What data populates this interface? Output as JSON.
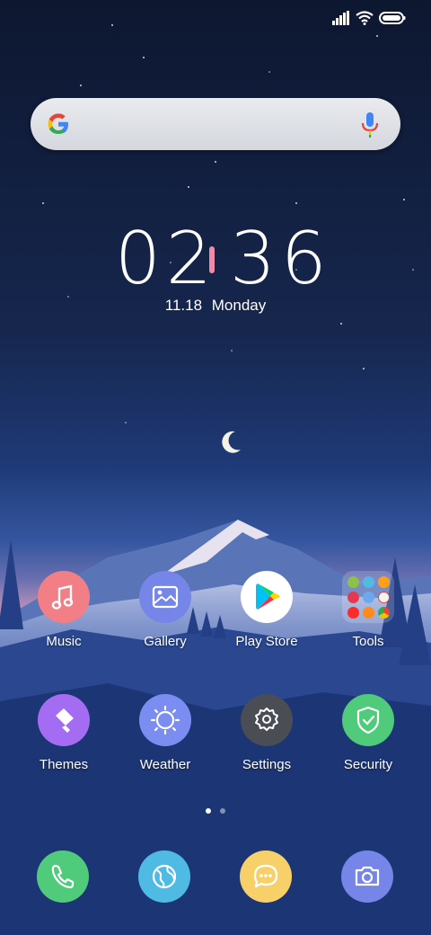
{
  "status_bar": {
    "icons": [
      "signal-icon",
      "wifi-icon",
      "battery-icon"
    ]
  },
  "search": {
    "icon": "google-icon",
    "voice_icon": "mic-icon"
  },
  "clock": {
    "hours": "02",
    "minutes": "36",
    "date": "11.18",
    "weekday": "Monday"
  },
  "apps_row1": [
    {
      "label": "Music",
      "icon": "music-note-icon",
      "color": "#f27f86"
    },
    {
      "label": "Gallery",
      "icon": "image-icon",
      "color": "#7585e8"
    },
    {
      "label": "Play Store",
      "icon": "play-store-icon",
      "color": "#ffffff"
    },
    {
      "label": "Tools",
      "icon": "folder-icon",
      "color": "#ffffff"
    }
  ],
  "apps_row2": [
    {
      "label": "Themes",
      "icon": "brush-icon",
      "color": "#a46cf2"
    },
    {
      "label": "Weather",
      "icon": "sun-icon",
      "color": "#7b8df0"
    },
    {
      "label": "Settings",
      "icon": "gear-icon",
      "color": "#4b4d55"
    },
    {
      "label": "Security",
      "icon": "shield-check-icon",
      "color": "#4fcb7b"
    }
  ],
  "page_indicator": {
    "pages": 2,
    "current": 1
  },
  "dock": [
    {
      "icon": "phone-icon",
      "color": "#4fcb7b"
    },
    {
      "icon": "globe-icon",
      "color": "#4fbbe4"
    },
    {
      "icon": "message-icon",
      "color": "#f8d069"
    },
    {
      "icon": "camera-icon",
      "color": "#7585e8"
    }
  ]
}
